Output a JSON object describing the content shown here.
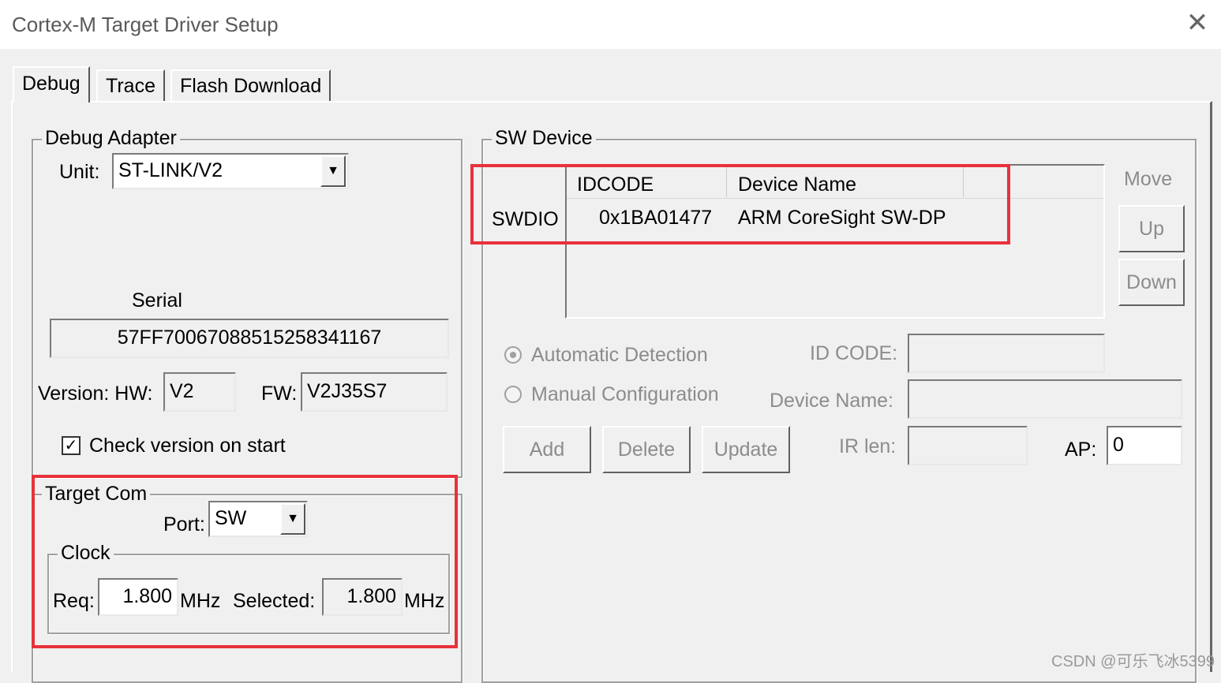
{
  "window": {
    "title": "Cortex-M Target Driver Setup",
    "close_glyph": "✕"
  },
  "tabs": [
    {
      "label": "Debug",
      "active": true
    },
    {
      "label": "Trace",
      "active": false
    },
    {
      "label": "Flash Download",
      "active": false
    }
  ],
  "debug_adapter": {
    "group_label": "Debug Adapter",
    "unit_label": "Unit:",
    "unit_value": "ST-LINK/V2",
    "serial_label": "Serial",
    "serial_value": "57FF70067088515258341167",
    "version_hw_label": "Version: HW:",
    "hw_value": "V2",
    "fw_label": "FW:",
    "fw_value": "V2J35S7",
    "check_label": "Check version on start",
    "check_checked": true,
    "check_glyph": "✓"
  },
  "target_com": {
    "group_label": "Target Com",
    "port_label": "Port:",
    "port_value": "SW",
    "clock_label": "Clock",
    "req_label": "Req:",
    "req_value": "1.800",
    "req_unit": "MHz",
    "selected_label": "Selected:",
    "selected_value": "1.800",
    "selected_unit": "MHz"
  },
  "sw_device": {
    "group_label": "SW Device",
    "columns": [
      "IDCODE",
      "Device Name"
    ],
    "rows": [
      {
        "row_label": "SWDIO",
        "idcode": "0x1BA01477",
        "device_name": "ARM CoreSight SW-DP"
      }
    ],
    "move_label": "Move",
    "up_label": "Up",
    "down_label": "Down",
    "auto_detect_label": "Automatic Detection",
    "manual_config_label": "Manual Configuration",
    "id_code_label": "ID CODE:",
    "device_name_label": "Device Name:",
    "ir_len_label": "IR len:",
    "ap_label": "AP:",
    "ap_value": "0",
    "add_label": "Add",
    "delete_label": "Delete",
    "update_label": "Update"
  },
  "combo_arrow_glyph": "▼",
  "watermark": "CSDN @可乐飞冰5399",
  "colors": {
    "highlight_red": "#e8313b",
    "disabled_text": "#8c8c8c"
  }
}
